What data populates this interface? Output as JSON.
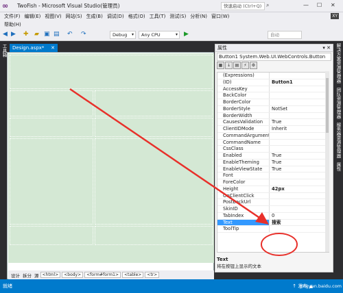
{
  "window": {
    "title": "TwoFish - Microsoft Visual Studio(管理员)",
    "quick_launch": "快速启动 (Ctrl+Q)",
    "min": "—",
    "max": "☐",
    "close": "✕"
  },
  "menu": [
    "文件(F)",
    "编辑(E)",
    "视图(V)",
    "网站(S)",
    "生成(B)",
    "调试(D)",
    "格式(O)",
    "工具(T)",
    "测试(S)",
    "分析(N)",
    "窗口(W)"
  ],
  "help_menu": "帮助(H)",
  "user_badge": "XY",
  "toolbar": {
    "config": "Debug",
    "platform": "Any CPU",
    "auto": "自动"
  },
  "left_strip": "工具箱",
  "document": {
    "tab": "Design.aspx*",
    "close": "✕"
  },
  "view_tabs": {
    "design": "设计",
    "split": "拆分",
    "source": "源"
  },
  "breadcrumbs": [
    "<html>",
    "<body>",
    "<form#form1>",
    "<table>",
    "<tr>"
  ],
  "properties": {
    "panel_title": "属性",
    "object": "Button1  System.Web.UI.WebControls.Button",
    "rows": [
      {
        "name": "(Expressions)",
        "value": ""
      },
      {
        "name": "(ID)",
        "value": "Button1",
        "bold": true
      },
      {
        "name": "AccessKey",
        "value": ""
      },
      {
        "name": "BackColor",
        "value": ""
      },
      {
        "name": "BorderColor",
        "value": ""
      },
      {
        "name": "BorderStyle",
        "value": "NotSet"
      },
      {
        "name": "BorderWidth",
        "value": ""
      },
      {
        "name": "CausesValidation",
        "value": "True"
      },
      {
        "name": "ClientIDMode",
        "value": "Inherit"
      },
      {
        "name": "CommandArgument",
        "value": ""
      },
      {
        "name": "CommandName",
        "value": ""
      },
      {
        "name": "CssClass",
        "value": ""
      },
      {
        "name": "Enabled",
        "value": "True"
      },
      {
        "name": "EnableTheming",
        "value": "True"
      },
      {
        "name": "EnableViewState",
        "value": "True"
      },
      {
        "name": "Font",
        "value": ""
      },
      {
        "name": "ForeColor",
        "value": ""
      },
      {
        "name": "Height",
        "value": "42px",
        "bold": true
      },
      {
        "name": "OnClientClick",
        "value": ""
      },
      {
        "name": "PostBackUrl",
        "value": ""
      },
      {
        "name": "SkinID",
        "value": ""
      },
      {
        "name": "TabIndex",
        "value": "0"
      },
      {
        "name": "Text",
        "value": "搜索",
        "bold": true,
        "selected": true
      },
      {
        "name": "ToolTip",
        "value": ""
      }
    ],
    "desc_title": "Text",
    "desc_text": "将在按钮上显示的文本"
  },
  "right_strip": [
    "解决方案资源管理器",
    "团队资源管理器",
    "服务器资源管理器",
    "属性"
  ],
  "status": {
    "left": "就绪",
    "right": "↑ 发布 ▲",
    "watermark": "jingyan.baidu.com"
  },
  "colors": {
    "accent": "#007acc",
    "design_bg": "#d4e8d4",
    "annotation": "#e8302a"
  }
}
